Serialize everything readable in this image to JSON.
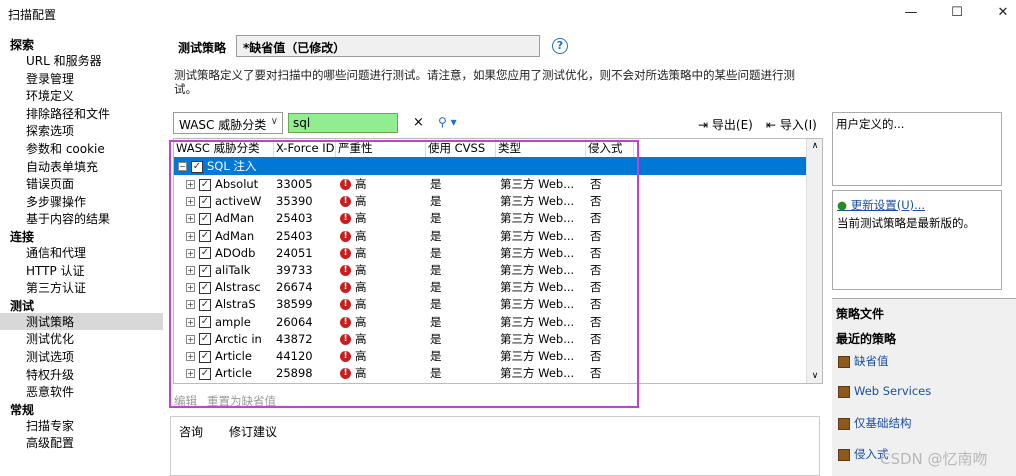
{
  "window": {
    "title": "扫描配置",
    "minimize": "—",
    "maximize": "☐",
    "close": "✕"
  },
  "nav": {
    "categories": [
      {
        "label": "探索",
        "items": [
          "URL 和服务器",
          "登录管理",
          "环境定义",
          "排除路径和文件",
          "探索选项",
          "参数和 cookie",
          "自动表单填充",
          "错误页面",
          "多步骤操作",
          "基于内容的结果"
        ]
      },
      {
        "label": "连接",
        "items": [
          "通信和代理",
          "HTTP 认证",
          "第三方认证"
        ]
      },
      {
        "label": "测试",
        "items": [
          "测试策略",
          "测试优化",
          "测试选项",
          "特权升级",
          "恶意软件"
        ]
      },
      {
        "label": "常规",
        "items": [
          "扫描专家",
          "高级配置"
        ]
      }
    ],
    "selected": "测试策略"
  },
  "policy": {
    "label": "测试策略",
    "value": "*缺省值（已修改）",
    "description": "测试策略定义了要对扫描中的哪些问题进行测试。请注意，如果您应用了测试优化，则不会对所选策略中的某些问题进行测试。"
  },
  "toolbar": {
    "filter_value": "WASC 威胁分类",
    "search_value": "sql",
    "clear": "×",
    "search_icon": "search-icon",
    "export_label": "导出(E)",
    "import_label": "导入(I)"
  },
  "grid": {
    "headers": [
      "WASC 威胁分类",
      "X-Force ID",
      "严重性",
      "使用 CVSS",
      "类型",
      "侵入式"
    ],
    "group": "SQL 注入",
    "rows": [
      {
        "name": "Absolut",
        "xforce": "33005",
        "severity": "高",
        "cvss": "是",
        "type": "第三方 Web...",
        "intrusive": "否"
      },
      {
        "name": "activeW",
        "xforce": "35390",
        "severity": "高",
        "cvss": "是",
        "type": "第三方 Web...",
        "intrusive": "否"
      },
      {
        "name": "AdMan",
        "xforce": "25403",
        "severity": "高",
        "cvss": "是",
        "type": "第三方 Web...",
        "intrusive": "否"
      },
      {
        "name": "AdMan",
        "xforce": "25403",
        "severity": "高",
        "cvss": "是",
        "type": "第三方 Web...",
        "intrusive": "否"
      },
      {
        "name": "ADOdb",
        "xforce": "24051",
        "severity": "高",
        "cvss": "是",
        "type": "第三方 Web...",
        "intrusive": "否"
      },
      {
        "name": "aliTalk",
        "xforce": "39733",
        "severity": "高",
        "cvss": "是",
        "type": "第三方 Web...",
        "intrusive": "否"
      },
      {
        "name": "Alstrasc",
        "xforce": "26674",
        "severity": "高",
        "cvss": "是",
        "type": "第三方 Web...",
        "intrusive": "否"
      },
      {
        "name": "AlstraS",
        "xforce": "38599",
        "severity": "高",
        "cvss": "是",
        "type": "第三方 Web...",
        "intrusive": "否"
      },
      {
        "name": "ample",
        "xforce": "26064",
        "severity": "高",
        "cvss": "是",
        "type": "第三方 Web...",
        "intrusive": "否"
      },
      {
        "name": "Arctic in",
        "xforce": "43872",
        "severity": "高",
        "cvss": "是",
        "type": "第三方 Web...",
        "intrusive": "否"
      },
      {
        "name": "Article",
        "xforce": "44120",
        "severity": "高",
        "cvss": "是",
        "type": "第三方 Web...",
        "intrusive": "否"
      },
      {
        "name": "Article",
        "xforce": "25898",
        "severity": "高",
        "cvss": "是",
        "type": "第三方 Web...",
        "intrusive": "否"
      }
    ]
  },
  "bottom": {
    "edit": "编辑",
    "reset": "重置为缺省值"
  },
  "tabs": [
    "咨询",
    "修订建议"
  ],
  "right": {
    "user_defined": "用户定义的...",
    "update_link": "更新设置(U)...",
    "status": "当前测试策略是最新版的。",
    "policy_files_header": "策略文件",
    "recent_header": "最近的策略",
    "recent": [
      "缺省值",
      "Web Services",
      "仅基础结构",
      "侵入式"
    ]
  },
  "watermark": "CSDN @忆南吻",
  "colors": {
    "selection": "#0078d7",
    "search_bg": "#90ee90",
    "highlight_border": "#c040d8",
    "severity_high": "#c81e1e",
    "link": "#1a4fa0"
  }
}
